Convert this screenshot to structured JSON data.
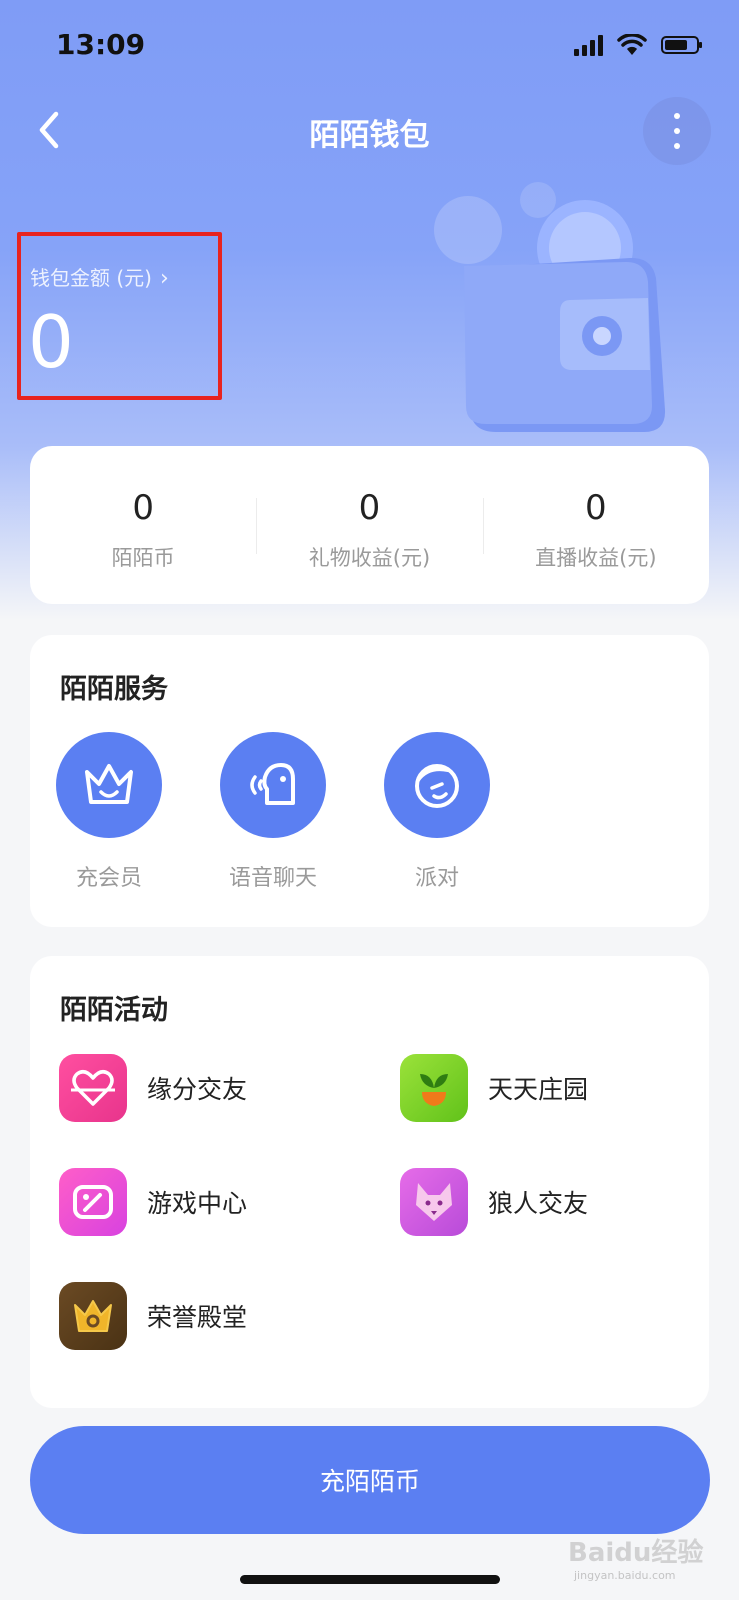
{
  "status_bar": {
    "time": "13:09"
  },
  "header": {
    "title": "陌陌钱包"
  },
  "balance": {
    "label": "钱包金额 (元)",
    "value": "0"
  },
  "stats": [
    {
      "value": "0",
      "label": "陌陌币"
    },
    {
      "value": "0",
      "label": "礼物收益(元)"
    },
    {
      "value": "0",
      "label": "直播收益(元)"
    }
  ],
  "services": {
    "title": "陌陌服务",
    "items": [
      {
        "label": "充会员",
        "icon": "crown-icon"
      },
      {
        "label": "语音聊天",
        "icon": "voice-chat-icon"
      },
      {
        "label": "派对",
        "icon": "party-face-icon"
      }
    ]
  },
  "activities": {
    "title": "陌陌活动",
    "items": [
      {
        "label": "缘分交友",
        "icon": "heart-link-icon",
        "color": "#f0439a"
      },
      {
        "label": "天天庄园",
        "icon": "sprout-icon",
        "color": "#7ed12a"
      },
      {
        "label": "游戏中心",
        "icon": "gamepad-icon",
        "color": "#e94fd8"
      },
      {
        "label": "狼人交友",
        "icon": "wolf-icon",
        "color": "#d65ae0"
      },
      {
        "label": "荣誉殿堂",
        "icon": "honor-crown-icon",
        "color": "#5a3d1c"
      }
    ]
  },
  "recharge_button": {
    "label": "充陌陌币"
  },
  "watermark": {
    "brand": "Baidu经验",
    "url": "jingyan.baidu.com"
  },
  "colors": {
    "accent": "#5b7ff2",
    "highlight_box": "#e8231f"
  }
}
